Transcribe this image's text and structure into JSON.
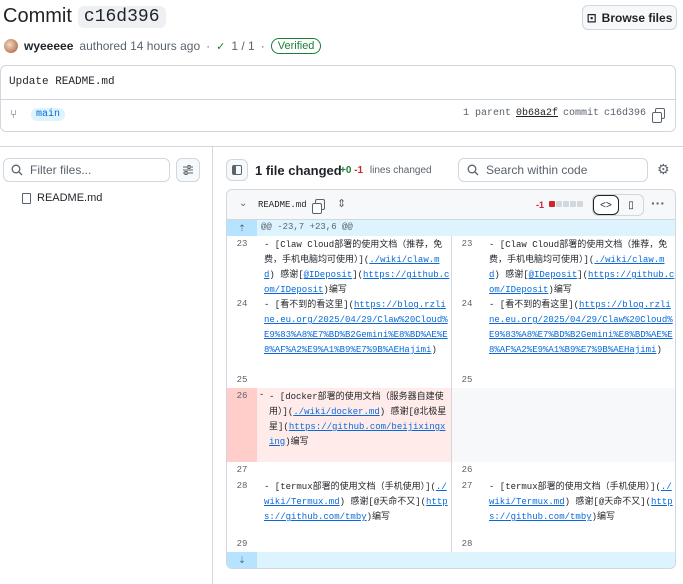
{
  "header": {
    "title_word": "Commit",
    "sha": "c16d396",
    "browse_label": "Browse files",
    "author": "wyeeeee",
    "authored_text": "authored 14 hours ago",
    "checks": "1 / 1",
    "verified": "Verified"
  },
  "commit": {
    "message": "Update README.md",
    "branch": "main",
    "parent_label": "1 parent",
    "parent_sha": "0b68a2f",
    "commit_label": "commit",
    "commit_sha": "c16d396"
  },
  "sidebar": {
    "filter_placeholder": "Filter files...",
    "files": [
      "README.md"
    ]
  },
  "toolbar": {
    "changed_label": "1 file changed",
    "added": "+0",
    "deleted": "-1",
    "lines_changed": "lines changed",
    "search_placeholder": "Search within code"
  },
  "diff": {
    "file_name": "README.md",
    "deleted_count": "-1",
    "hunk_header": "@@ -23,7 +23,6 @@",
    "rows": [
      {
        "ln_left": "23",
        "ln_right": "23"
      },
      {
        "ln_left": "24",
        "ln_right": "24"
      },
      {
        "ln_left": "25",
        "ln_right": "25"
      },
      {
        "ln_left": "26",
        "ln_right": ""
      },
      {
        "ln_left": "27",
        "ln_right": "26"
      },
      {
        "ln_left": "28",
        "ln_right": "27"
      },
      {
        "ln_left": "29",
        "ln_right": "28"
      }
    ],
    "line23_a": "- [Claw Cloud部署的使用文档（推荐，免费，手机电脑均可使用）](",
    "line23_link1": "./wiki/claw.md",
    "line23_b": ") 感谢[",
    "line23_link2": "@IDeposit",
    "line23_c": "](",
    "line23_link3": "https://github.com/IDeposit",
    "line23_d": ")编写",
    "line24_a": "- [看不到的看这里](",
    "line24_link": "https://blog.rzline.eu.org/2025/04/29/Claw%20Cloud%E9%83%A8%E7%BD%B2Gemini%E8%BD%AE%E8%AF%A2%E9%A1%B9%E7%9B%AEHajimi",
    "line24_b": ")",
    "line26_mark": "-",
    "line26_a": "- [docker部署的使用文档（服务器自建使用）](",
    "line26_link1": "./wiki/docker.md",
    "line26_b": ") 感谢[@北极星星](",
    "line26_link2": "https://github.com/beijixingxing",
    "line26_c": ")编写",
    "line28_a": "- [termux部署的使用文档（手机使用）](",
    "line28_link1": "./wiki/Termux.md",
    "line28_b": ") 感谢[@天命不又](",
    "line28_link2": "https://github.com/tmby",
    "line28_c": ")编写"
  }
}
